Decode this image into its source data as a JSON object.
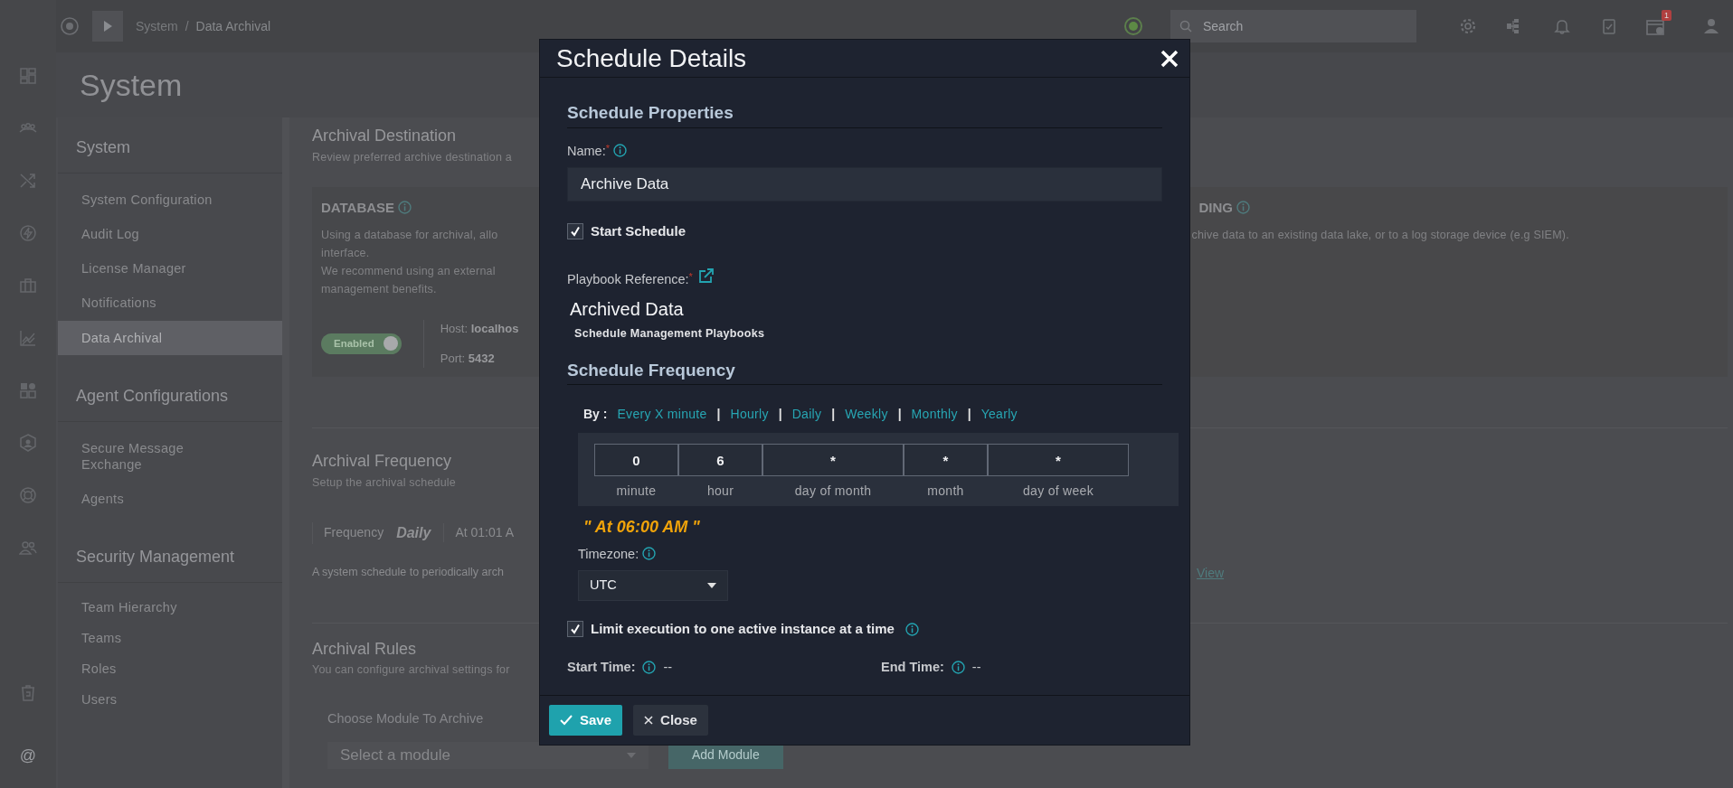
{
  "topbar": {
    "breadcrumb": [
      {
        "label": "System"
      },
      {
        "label": "Data Archival"
      }
    ],
    "separator": "/",
    "search": {
      "placeholder": "Search"
    },
    "notification_badge": "1"
  },
  "rail_footer_glyph": "@",
  "page_title": "System",
  "nav": [
    {
      "heading": "System",
      "items": [
        {
          "label": "System Configuration",
          "selected": false
        },
        {
          "label": "Audit Log",
          "selected": false
        },
        {
          "label": "License Manager",
          "selected": false
        },
        {
          "label": "Notifications",
          "selected": false
        },
        {
          "label": "Data Archival",
          "selected": true
        }
      ]
    },
    {
      "heading": "Agent Configurations",
      "items": [
        {
          "label": "Secure Message Exchange",
          "selected": false
        },
        {
          "label": "Agents",
          "selected": false
        }
      ]
    },
    {
      "heading": "Security Management",
      "items": [
        {
          "label": "Team Hierarchy",
          "selected": false
        },
        {
          "label": "Teams",
          "selected": false
        },
        {
          "label": "Roles",
          "selected": false
        },
        {
          "label": "Users",
          "selected": false
        }
      ]
    }
  ],
  "archival_destination": {
    "title": "Archival Destination",
    "subtitle": "Review preferred archive destination a",
    "database": {
      "title": "DATABASE",
      "lines": [
        "Using a database for archival, allo",
        "interface.",
        "We recommend using an external",
        "management benefits."
      ],
      "toggle": {
        "label": "Enabled",
        "on": true
      },
      "host_label": "Host:",
      "host": "localhos",
      "port_label": "Port:",
      "port": "5432"
    },
    "external": {
      "title": "DING",
      "description": "chive data to an existing data lake, or to a log storage device (e.g SIEM)."
    }
  },
  "archival_frequency": {
    "title": "Archival Frequency",
    "subtitle": "Setup the archival schedule",
    "frequency_label": "Frequency",
    "frequency": "Daily",
    "time": "At 01:01 A",
    "note": "A system schedule to periodically arch",
    "view_link": "View"
  },
  "archival_rules": {
    "title": "Archival Rules",
    "subtitle": "You can configure archival settings for",
    "choose_label": "Choose Module To Archive",
    "select_placeholder": "Select a module",
    "add_button": "Add Module"
  },
  "modal": {
    "title": "Schedule Details",
    "properties_heading": "Schedule Properties",
    "name_field": {
      "label": "Name:",
      "required_mark": "*",
      "value": "Archive Data"
    },
    "start_schedule": {
      "label": "Start Schedule",
      "checked": true
    },
    "playbook": {
      "label": "Playbook Reference:",
      "required_mark": "*",
      "name": "Archived Data",
      "collection": "Schedule Management Playbooks"
    },
    "frequency_heading": "Schedule Frequency",
    "by_label": "By :",
    "by_separator": "|",
    "by_options": [
      {
        "label": "Every X minute"
      },
      {
        "label": "Hourly"
      },
      {
        "label": "Daily"
      },
      {
        "label": "Weekly"
      },
      {
        "label": "Monthly"
      },
      {
        "label": "Yearly"
      }
    ],
    "cron": [
      {
        "value": "0",
        "label": "minute",
        "kind": "narrow"
      },
      {
        "value": "6",
        "label": "hour",
        "kind": "narrow"
      },
      {
        "value": "*",
        "label": "day of month",
        "kind": "wide"
      },
      {
        "value": "*",
        "label": "month",
        "kind": "narrow"
      },
      {
        "value": "*",
        "label": "day of week",
        "kind": "wide"
      }
    ],
    "summary": "\" At 06:00 AM \"",
    "timezone": {
      "label": "Timezone:",
      "value": "UTC"
    },
    "limit_execution": {
      "label": "Limit execution to one active instance at a time",
      "checked": true
    },
    "start_time": {
      "label": "Start Time:",
      "value": "--"
    },
    "end_time": {
      "label": "End Time:",
      "value": "--"
    },
    "buttons": [
      {
        "label": "Save",
        "kind": "primary"
      },
      {
        "label": "Close",
        "kind": "secondary"
      }
    ]
  }
}
